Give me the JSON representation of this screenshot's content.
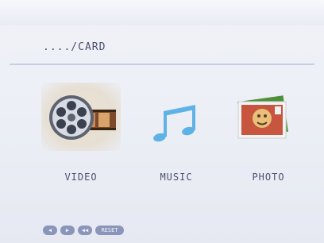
{
  "path": {
    "text": "..../CARD"
  },
  "menu": [
    {
      "label": "VIDEO",
      "icon": "film-reel-icon",
      "selected": true
    },
    {
      "label": "MUSIC",
      "icon": "music-note-icon",
      "selected": false
    },
    {
      "label": "PHOTO",
      "icon": "photo-icon",
      "selected": false
    }
  ],
  "footer": {
    "buttons": [
      {
        "label": "◀",
        "icon": "left-arrow-icon"
      },
      {
        "label": "▶",
        "icon": "right-arrow-icon"
      },
      {
        "label": "◀◀",
        "icon": "back-icon"
      },
      {
        "label": "RESET",
        "icon": "reset-icon"
      }
    ]
  },
  "colors": {
    "background": "#eceff6",
    "text": "#4a4f6e",
    "accent": "#8b95ba",
    "music_icon": "#5fb2e6",
    "selection": "#e6dfd3"
  }
}
